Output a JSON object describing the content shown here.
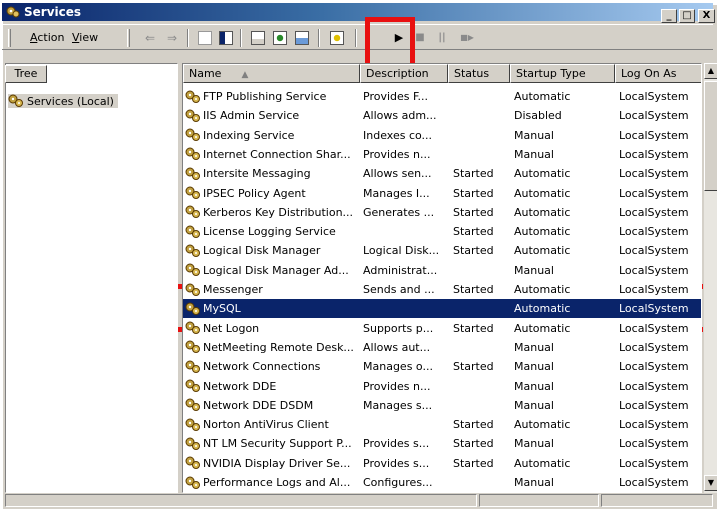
{
  "window": {
    "title": "Services"
  },
  "window_controls": {
    "minimize": "_",
    "maximize": "□",
    "close": "X"
  },
  "menu": [
    {
      "label": "Action",
      "underline": "A"
    },
    {
      "label": "View",
      "underline": "V"
    }
  ],
  "toolbar": {
    "back": "⇐",
    "forward": "⇒",
    "play": "▶",
    "stop": "■",
    "pause": "||",
    "restart": "■▶"
  },
  "tree": {
    "tab_label": "Tree",
    "item_label": "Services (Local)"
  },
  "columns": [
    "Name",
    "Description",
    "Status",
    "Startup Type",
    "Log On As"
  ],
  "sort_indicator": "▲",
  "services": [
    {
      "name": "FTP Publishing Service",
      "description": "Provides F...",
      "status": "",
      "startup": "Automatic",
      "logon": "LocalSystem"
    },
    {
      "name": "IIS Admin Service",
      "description": "Allows adm...",
      "status": "",
      "startup": "Disabled",
      "logon": "LocalSystem"
    },
    {
      "name": "Indexing Service",
      "description": "Indexes co...",
      "status": "",
      "startup": "Manual",
      "logon": "LocalSystem"
    },
    {
      "name": "Internet Connection Shar...",
      "description": "Provides n...",
      "status": "",
      "startup": "Manual",
      "logon": "LocalSystem"
    },
    {
      "name": "Intersite Messaging",
      "description": "Allows sen...",
      "status": "Started",
      "startup": "Automatic",
      "logon": "LocalSystem"
    },
    {
      "name": "IPSEC Policy Agent",
      "description": "Manages I...",
      "status": "Started",
      "startup": "Automatic",
      "logon": "LocalSystem"
    },
    {
      "name": "Kerberos Key Distribution...",
      "description": "Generates ...",
      "status": "Started",
      "startup": "Automatic",
      "logon": "LocalSystem"
    },
    {
      "name": "License Logging Service",
      "description": "",
      "status": "Started",
      "startup": "Automatic",
      "logon": "LocalSystem"
    },
    {
      "name": "Logical Disk Manager",
      "description": "Logical Disk...",
      "status": "Started",
      "startup": "Automatic",
      "logon": "LocalSystem"
    },
    {
      "name": "Logical Disk Manager Ad...",
      "description": "Administrat...",
      "status": "",
      "startup": "Manual",
      "logon": "LocalSystem"
    },
    {
      "name": "Messenger",
      "description": "Sends and ...",
      "status": "Started",
      "startup": "Automatic",
      "logon": "LocalSystem"
    },
    {
      "name": "MySQL",
      "description": "",
      "status": "",
      "startup": "Automatic",
      "logon": "LocalSystem",
      "selected": true
    },
    {
      "name": "Net Logon",
      "description": "Supports p...",
      "status": "Started",
      "startup": "Automatic",
      "logon": "LocalSystem"
    },
    {
      "name": "NetMeeting Remote Desk...",
      "description": "Allows aut...",
      "status": "",
      "startup": "Manual",
      "logon": "LocalSystem"
    },
    {
      "name": "Network Connections",
      "description": "Manages o...",
      "status": "Started",
      "startup": "Manual",
      "logon": "LocalSystem"
    },
    {
      "name": "Network DDE",
      "description": "Provides n...",
      "status": "",
      "startup": "Manual",
      "logon": "LocalSystem"
    },
    {
      "name": "Network DDE DSDM",
      "description": "Manages s...",
      "status": "",
      "startup": "Manual",
      "logon": "LocalSystem"
    },
    {
      "name": "Norton AntiVirus Client",
      "description": "",
      "status": "Started",
      "startup": "Automatic",
      "logon": "LocalSystem"
    },
    {
      "name": "NT LM Security Support P...",
      "description": "Provides s...",
      "status": "Started",
      "startup": "Manual",
      "logon": "LocalSystem"
    },
    {
      "name": "NVIDIA Display Driver Se...",
      "description": "Provides s...",
      "status": "Started",
      "startup": "Automatic",
      "logon": "LocalSystem"
    },
    {
      "name": "Performance Logs and Al...",
      "description": "Configures...",
      "status": "",
      "startup": "Manual",
      "logon": "LocalSystem"
    }
  ],
  "colors": {
    "selection": "#0a246a",
    "highlight_box": "#e81010",
    "title_start": "#0a246a",
    "title_end": "#a6caf0"
  },
  "icons": {
    "service": "gear-icon",
    "up_arrow": "▲",
    "down_arrow": "▼"
  }
}
